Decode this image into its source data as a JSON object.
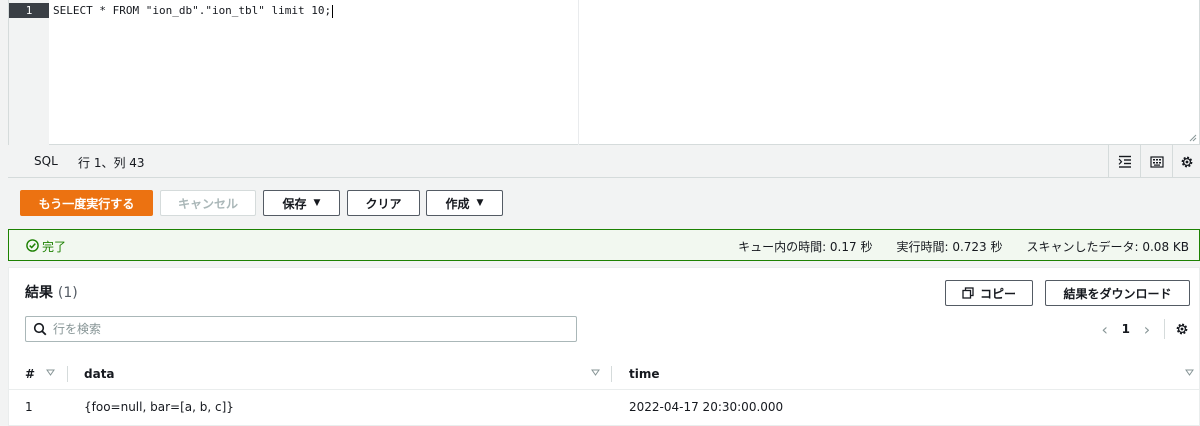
{
  "editor": {
    "line_number": "1",
    "sql_text": "SELECT * FROM \"ion_db\".\"ion_tbl\" limit 10;"
  },
  "statusbar": {
    "language": "SQL",
    "cursor_position": "行 1、列 43",
    "icons": [
      "indent-icon",
      "keyboard-icon",
      "gear-icon"
    ]
  },
  "actions": {
    "rerun_label": "もう一度実行する",
    "cancel_label": "キャンセル",
    "save_label": "保存",
    "clear_label": "クリア",
    "create_label": "作成"
  },
  "status": {
    "completed_label": "完了",
    "queue_time": "キュー内の時間: 0.17 秒",
    "run_time": "実行時間: 0.723 秒",
    "data_scanned": "スキャンしたデータ: 0.08 KB"
  },
  "results": {
    "title": "結果",
    "count": "(1)",
    "copy_label": "コピー",
    "download_label": "結果をダウンロード",
    "search_placeholder": "行を検索",
    "search_value": "",
    "page": "1",
    "columns": [
      "#",
      "data",
      "time"
    ],
    "rows": [
      {
        "num": "1",
        "data": "{foo=null, bar=[a, b, c]}",
        "time": "2022-04-17 20:30:00.000"
      }
    ]
  },
  "colors": {
    "primary": "#ec7211",
    "success": "#1d8102",
    "success_bg": "#f2f8f0",
    "gutter_active": "#3a3f45"
  }
}
